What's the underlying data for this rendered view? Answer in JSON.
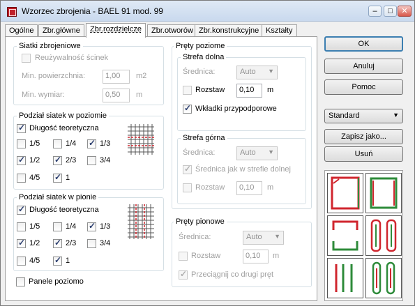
{
  "window": {
    "title": "Wzorzec zbrojenia - BAEL 91 mod. 99",
    "minimize": "–",
    "maximize": "□",
    "close": "✕"
  },
  "tabs": [
    "Ogólne",
    "Zbr.główne",
    "Zbr.rozdzielcze",
    "Zbr.otworów",
    "Zbr.konstrukcyjne",
    "Kształty"
  ],
  "siatki": {
    "title": "Siatki zbrojeniowe",
    "reuse_label": "Reużywalność ścinek",
    "min_area_label": "Min. powierzchnia:",
    "min_area_value": "1,00",
    "min_area_unit": "m2",
    "min_dim_label": "Min. wymiar:",
    "min_dim_value": "0,50",
    "min_dim_unit": "m"
  },
  "poziom": {
    "title": "Podział siatek w poziomie",
    "dlugosc": "Długość teoretyczna",
    "options": [
      "1/5",
      "1/4",
      "1/3",
      "1/2",
      "2/3",
      "3/4",
      "4/5",
      "1"
    ]
  },
  "pion": {
    "title": "Podział siatek w pionie",
    "dlugosc": "Długość teoretyczna",
    "options": [
      "1/5",
      "1/4",
      "1/3",
      "1/2",
      "2/3",
      "3/4",
      "4/5",
      "1"
    ]
  },
  "panele": "Panele poziomo",
  "prety_poziome": {
    "title": "Pręty poziome",
    "dolna": {
      "title": "Strefa dolna",
      "srednica": "Średnica:",
      "srednica_value": "Auto",
      "rozstaw": "Rozstaw",
      "rozstaw_value": "0,10",
      "unit": "m",
      "wkladki": "Wkładki przypodporowe"
    },
    "gorna": {
      "title": "Strefa górna",
      "srednica": "Średnica:",
      "srednica_value": "Auto",
      "jak": "Średnica jak w strefie dolnej",
      "rozstaw": "Rozstaw",
      "rozstaw_value": "0,10",
      "unit": "m"
    }
  },
  "prety_pionowe": {
    "title": "Pręty pionowe",
    "srednica": "Średnica:",
    "srednica_value": "Auto",
    "rozstaw": "Rozstaw",
    "rozstaw_value": "0,10",
    "unit": "m",
    "przeciagnij": "Przeciągnij co drugi pręt"
  },
  "buttons": {
    "ok": "OK",
    "cancel": "Anuluj",
    "help": "Pomoc",
    "standard": "Standard",
    "save_as": "Zapisz jako...",
    "delete": "Usuń"
  },
  "colors": {
    "rebar_red": "#d0262e",
    "rebar_green": "#2e8b3a"
  }
}
